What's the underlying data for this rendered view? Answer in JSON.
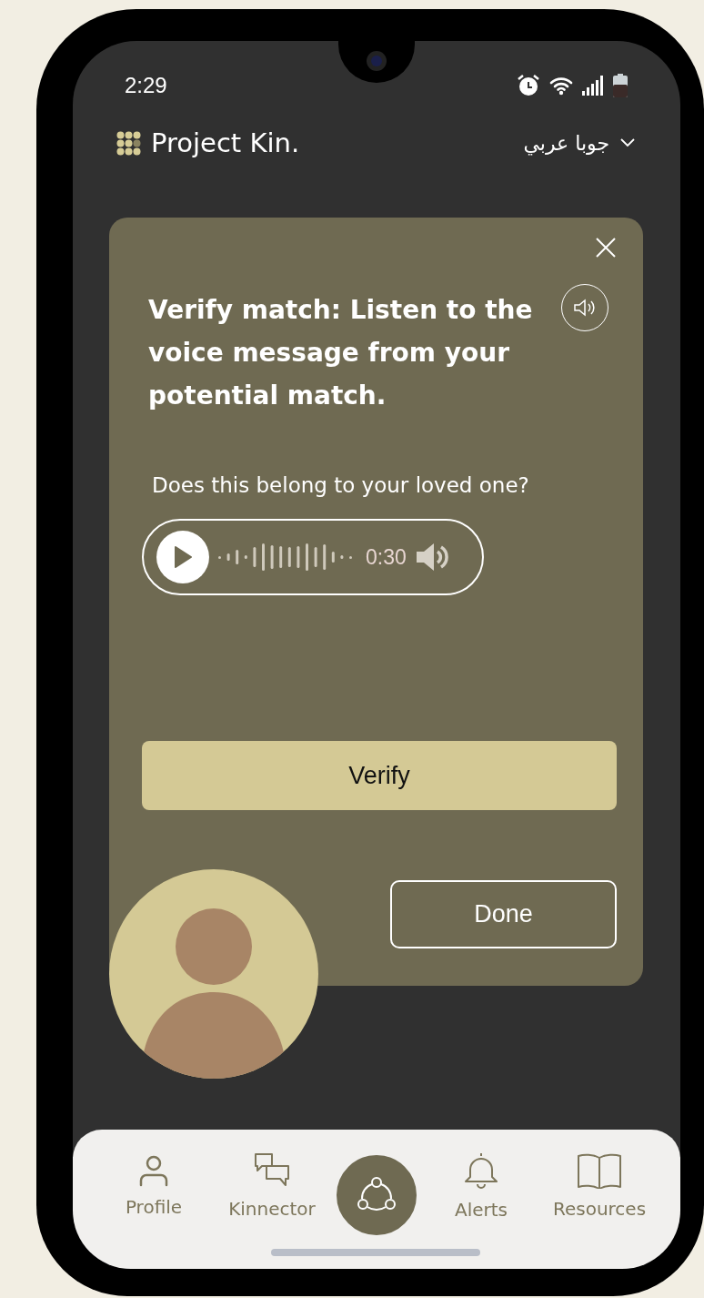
{
  "status_bar": {
    "time": "2:29"
  },
  "header": {
    "brand": "Project Kin.",
    "language": "جوبا عربي"
  },
  "card": {
    "title": "Verify match: Listen to the voice message from your potential match.",
    "question": "Does this belong to your loved one?",
    "audio": {
      "playing": false,
      "duration": "0:30"
    },
    "primary_button": "Verify",
    "secondary_button": "Done"
  },
  "nav": [
    {
      "kind": "profile",
      "label": "Profile",
      "selected": false
    },
    {
      "kind": "chat",
      "label": "Kinnector",
      "selected": false
    },
    {
      "kind": "hub",
      "selected": true
    },
    {
      "kind": "alerts",
      "label": "Alerts",
      "selected": false
    },
    {
      "kind": "resources",
      "label": "Resources",
      "selected": false
    }
  ]
}
